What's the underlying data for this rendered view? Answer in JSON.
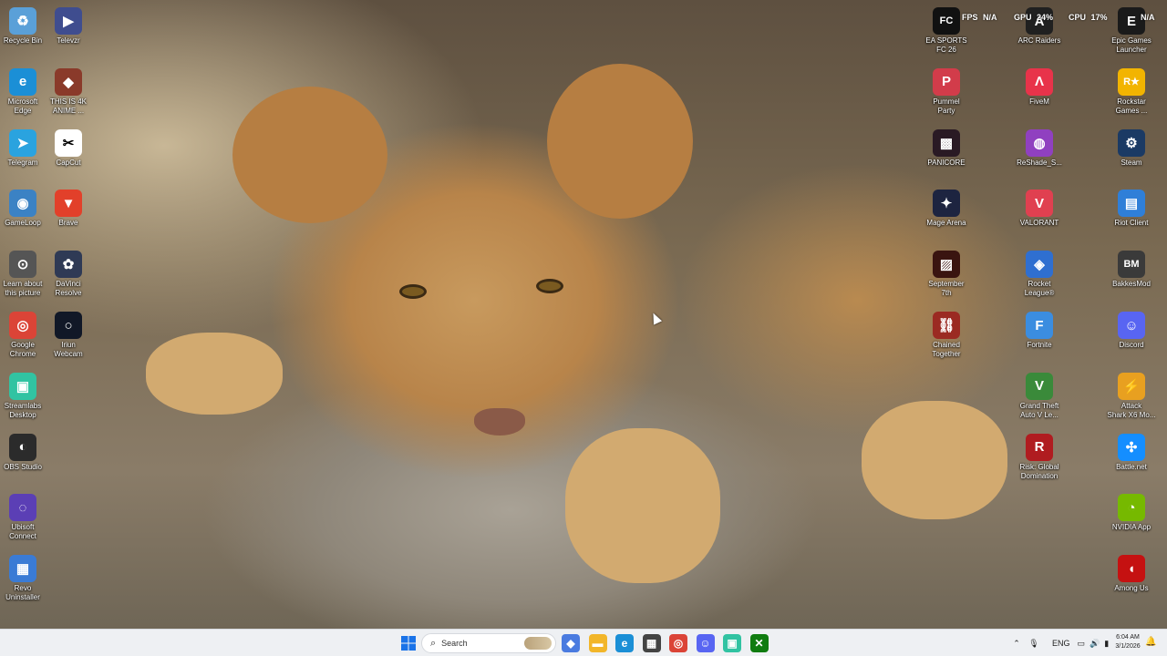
{
  "desktop": {
    "left_column_1": [
      {
        "label": "Recycle Bin",
        "icon": "recycle-bin-icon",
        "color": "#5aa0d8",
        "glyph": "♻"
      },
      {
        "label": "Microsoft\nEdge",
        "icon": "edge-icon",
        "color": "#1b8fd6",
        "glyph": "e"
      },
      {
        "label": "Telegram",
        "icon": "telegram-icon",
        "color": "#2aa3df",
        "glyph": "➤"
      },
      {
        "label": "GameLoop",
        "icon": "gameloop-icon",
        "color": "#3b82c4",
        "glyph": "◉"
      },
      {
        "label": "Learn about\nthis picture",
        "icon": "learn-about-picture-icon",
        "color": "#555555",
        "glyph": "⊙"
      },
      {
        "label": "Google\nChrome",
        "icon": "chrome-icon",
        "color": "#db4437",
        "glyph": "◎"
      },
      {
        "label": "Streamlabs\nDesktop",
        "icon": "streamlabs-icon",
        "color": "#31c3a2",
        "glyph": "▣"
      },
      {
        "label": "OBS Studio",
        "icon": "obs-icon",
        "color": "#2b2b2b",
        "glyph": "◐"
      },
      {
        "label": "Ubisoft\nConnect",
        "icon": "ubisoft-icon",
        "color": "#5b3fb5",
        "glyph": "◌"
      },
      {
        "label": "Revo\nUninstaller",
        "icon": "revo-uninstaller-icon",
        "color": "#3a7bd5",
        "glyph": "▦"
      }
    ],
    "left_column_2": [
      {
        "label": "Televzr",
        "icon": "televzr-icon",
        "color": "#3f4d8f",
        "glyph": "▶"
      },
      {
        "label": "THIS IS 4K\nANIME ...",
        "icon": "anime-folder-icon",
        "color": "#8a3a2a",
        "glyph": "◆"
      },
      {
        "label": "CapCut",
        "icon": "capcut-icon",
        "color": "#ffffff",
        "glyph": "✂"
      },
      {
        "label": "Brave",
        "icon": "brave-icon",
        "color": "#e2402a",
        "glyph": "▼"
      },
      {
        "label": "DaVinci\nResolve",
        "icon": "davinci-resolve-icon",
        "color": "#2f3a55",
        "glyph": "✿"
      },
      {
        "label": "Iriun\nWebcam",
        "icon": "iriun-webcam-icon",
        "color": "#111827",
        "glyph": "○"
      }
    ],
    "right_column_1": [
      {
        "label": "EA SPORTS\nFC 26",
        "icon": "ea-sports-fc-icon",
        "color": "#111111",
        "glyph": "FC"
      },
      {
        "label": "Pummel\nParty",
        "icon": "pummel-party-icon",
        "color": "#d23c4a",
        "glyph": "P"
      },
      {
        "label": "PANICORE",
        "icon": "panicore-icon",
        "color": "#2a1a24",
        "glyph": "▩"
      },
      {
        "label": "Mage Arena",
        "icon": "mage-arena-icon",
        "color": "#1d2440",
        "glyph": "✦"
      },
      {
        "label": "September\n7th",
        "icon": "september-7th-icon",
        "color": "#3a1410",
        "glyph": "▨"
      },
      {
        "label": "Chained\nTogether",
        "icon": "chained-together-icon",
        "color": "#9b2a22",
        "glyph": "⛓"
      }
    ],
    "right_column_2": [
      {
        "label": "ARC Raiders",
        "icon": "arc-raiders-icon",
        "color": "#202020",
        "glyph": "A"
      },
      {
        "label": "FiveM",
        "icon": "fivem-icon",
        "color": "#e8334a",
        "glyph": "Λ"
      },
      {
        "label": "ReShade_S...",
        "icon": "reshade-icon",
        "color": "#9040c0",
        "glyph": "◍"
      },
      {
        "label": "VALORANT",
        "icon": "valorant-icon",
        "color": "#e04050",
        "glyph": "V"
      },
      {
        "label": "Rocket\nLeague®",
        "icon": "rocket-league-icon",
        "color": "#2f6fd0",
        "glyph": "◈"
      },
      {
        "label": "Fortnite",
        "icon": "fortnite-icon",
        "color": "#3b8de0",
        "glyph": "F"
      },
      {
        "label": "Grand Theft\nAuto V Le...",
        "icon": "gta-v-icon",
        "color": "#3a8a3a",
        "glyph": "V"
      },
      {
        "label": "Risk: Global\nDomination",
        "icon": "risk-icon",
        "color": "#b01c20",
        "glyph": "R"
      }
    ],
    "right_column_3": [
      {
        "label": "Epic Games\nLauncher",
        "icon": "epic-games-icon",
        "color": "#1a1a1a",
        "glyph": "E"
      },
      {
        "label": "Rockstar\nGames ...",
        "icon": "rockstar-icon",
        "color": "#f2b400",
        "glyph": "R★"
      },
      {
        "label": "Steam",
        "icon": "steam-icon",
        "color": "#1b3a64",
        "glyph": "⚙"
      },
      {
        "label": "Riot Client",
        "icon": "riot-client-icon",
        "color": "#2f7fd8",
        "glyph": "▤"
      },
      {
        "label": "BakkesMod",
        "icon": "bakkesmod-icon",
        "color": "#3a3a3a",
        "glyph": "BM"
      },
      {
        "label": "Discord",
        "icon": "discord-icon",
        "color": "#5865f2",
        "glyph": "☺"
      },
      {
        "label": "Attack\nShark X6 Mo...",
        "icon": "attack-shark-icon",
        "color": "#e8a020",
        "glyph": "⚡"
      },
      {
        "label": "Battle.net",
        "icon": "battlenet-icon",
        "color": "#148eff",
        "glyph": "✣"
      },
      {
        "label": "NVIDIA App",
        "icon": "nvidia-icon",
        "color": "#76b900",
        "glyph": "◔"
      },
      {
        "label": "Among Us",
        "icon": "among-us-icon",
        "color": "#c51111",
        "glyph": "◖"
      }
    ]
  },
  "overlay": {
    "fps_label": "FPS",
    "fps_value": "N/A",
    "gpu_label": "GPU",
    "gpu_value": "24%",
    "cpu_label": "CPU",
    "cpu_value": "17%",
    "extra_value": "N/A"
  },
  "taskbar": {
    "search_placeholder": "Search",
    "apps": [
      {
        "name": "copilot-icon",
        "color": "#4a7be0",
        "glyph": "◆"
      },
      {
        "name": "file-explorer-icon",
        "color": "#f2b62a",
        "glyph": "▬"
      },
      {
        "name": "edge-taskbar-icon",
        "color": "#1b8fd6",
        "glyph": "e"
      },
      {
        "name": "store-icon",
        "color": "#444444",
        "glyph": "▦"
      },
      {
        "name": "chrome-taskbar-icon",
        "color": "#db4437",
        "glyph": "◎"
      },
      {
        "name": "discord-taskbar-icon",
        "color": "#5865f2",
        "glyph": "☺"
      },
      {
        "name": "streamlabs-taskbar-icon",
        "color": "#31c3a2",
        "glyph": "▣"
      },
      {
        "name": "xbox-icon",
        "color": "#107c10",
        "glyph": "✕"
      }
    ],
    "tray": {
      "language": "ENG",
      "time": "6:04 AM",
      "date": "3/1/2026"
    }
  }
}
